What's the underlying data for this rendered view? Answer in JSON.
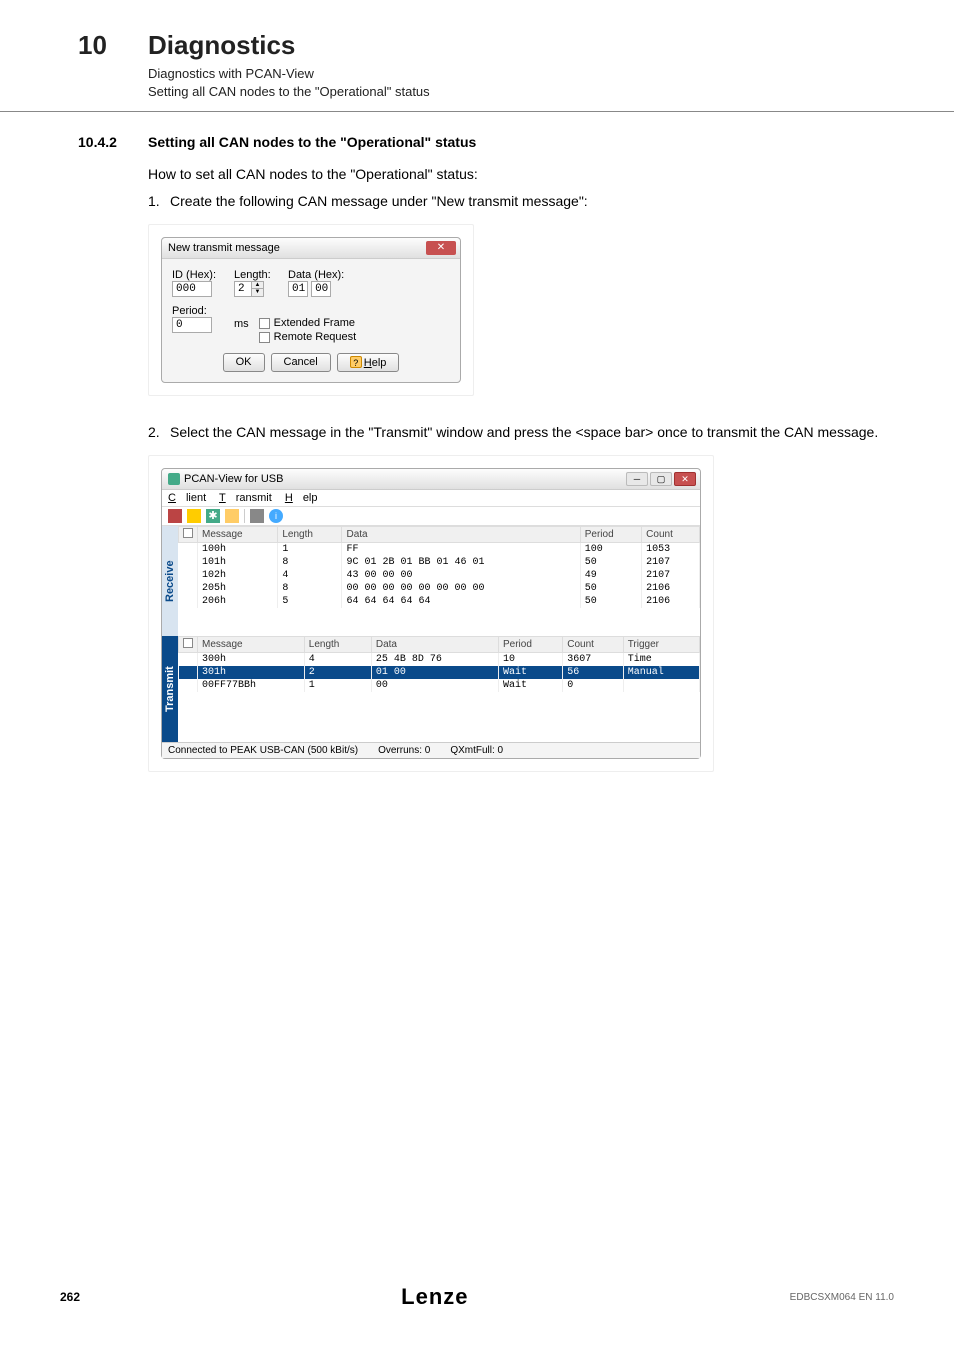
{
  "header": {
    "chapter_num": "10",
    "chapter_title": "Diagnostics",
    "sub1": "Diagnostics with PCAN-View",
    "sub2": "Setting all CAN nodes to the \"Operational\" status"
  },
  "section": {
    "num": "10.4.2",
    "title": "Setting all CAN nodes to the \"Operational\" status",
    "intro": "How to set all CAN nodes to the \"Operational\" status:",
    "step1": "Create the following CAN message under \"New transmit message\":",
    "step2": "Select the CAN message in the \"Transmit\" window and press the <space bar> once to transmit the CAN message."
  },
  "dialog1": {
    "title": "New transmit message",
    "id_label": "ID (Hex):",
    "id_value": "000",
    "length_label": "Length:",
    "length_value": "2",
    "data_label": "Data (Hex):",
    "data_v1": "01",
    "data_v2": "00",
    "period_label": "Period:",
    "period_value": "0",
    "period_unit": "ms",
    "cb_ext": "Extended Frame",
    "cb_rem": "Remote Request",
    "btn_ok": "OK",
    "btn_cancel": "Cancel",
    "btn_help": "Help"
  },
  "dialog2": {
    "title": "PCAN-View for USB",
    "menu": {
      "client": "Client",
      "transmit": "Transmit",
      "help": "Help"
    },
    "receive_label": "Receive",
    "transmit_label": "Transmit",
    "headers1": {
      "msg": "Message",
      "len": "Length",
      "data": "Data",
      "period": "Period",
      "count": "Count"
    },
    "headers2": {
      "msg": "Message",
      "len": "Length",
      "data": "Data",
      "period": "Period",
      "count": "Count",
      "trigger": "Trigger"
    },
    "receive_rows": [
      {
        "msg": "100h",
        "len": "1",
        "data": "FF",
        "period": "100",
        "count": "1053"
      },
      {
        "msg": "101h",
        "len": "8",
        "data": "9C 01 2B 01 BB 01 46 01",
        "period": "50",
        "count": "2107"
      },
      {
        "msg": "102h",
        "len": "4",
        "data": "43 00 00 00",
        "period": "49",
        "count": "2107"
      },
      {
        "msg": "205h",
        "len": "8",
        "data": "00 00 00 00 00 00 00 00",
        "period": "50",
        "count": "2106"
      },
      {
        "msg": "206h",
        "len": "5",
        "data": "64 64 64 64 64",
        "period": "50",
        "count": "2106"
      }
    ],
    "transmit_rows": [
      {
        "msg": "300h",
        "len": "4",
        "data": "25 4B 8D 76",
        "period": "10",
        "count": "3607",
        "trigger": "Time"
      },
      {
        "msg": "301h",
        "len": "2",
        "data": "01 00",
        "period": "Wait",
        "count": "56",
        "trigger": "Manual"
      },
      {
        "msg": "00FF77BBh",
        "len": "1",
        "data": "00",
        "period": "Wait",
        "count": "0",
        "trigger": ""
      }
    ],
    "status": {
      "conn": "Connected to PEAK USB-CAN (500 kBit/s)",
      "overruns": "Overruns: 0",
      "qxmt": "QXmtFull: 0"
    }
  },
  "footer": {
    "page": "262",
    "logo": "Lenze",
    "docid": "EDBCSXM064 EN 11.0"
  }
}
